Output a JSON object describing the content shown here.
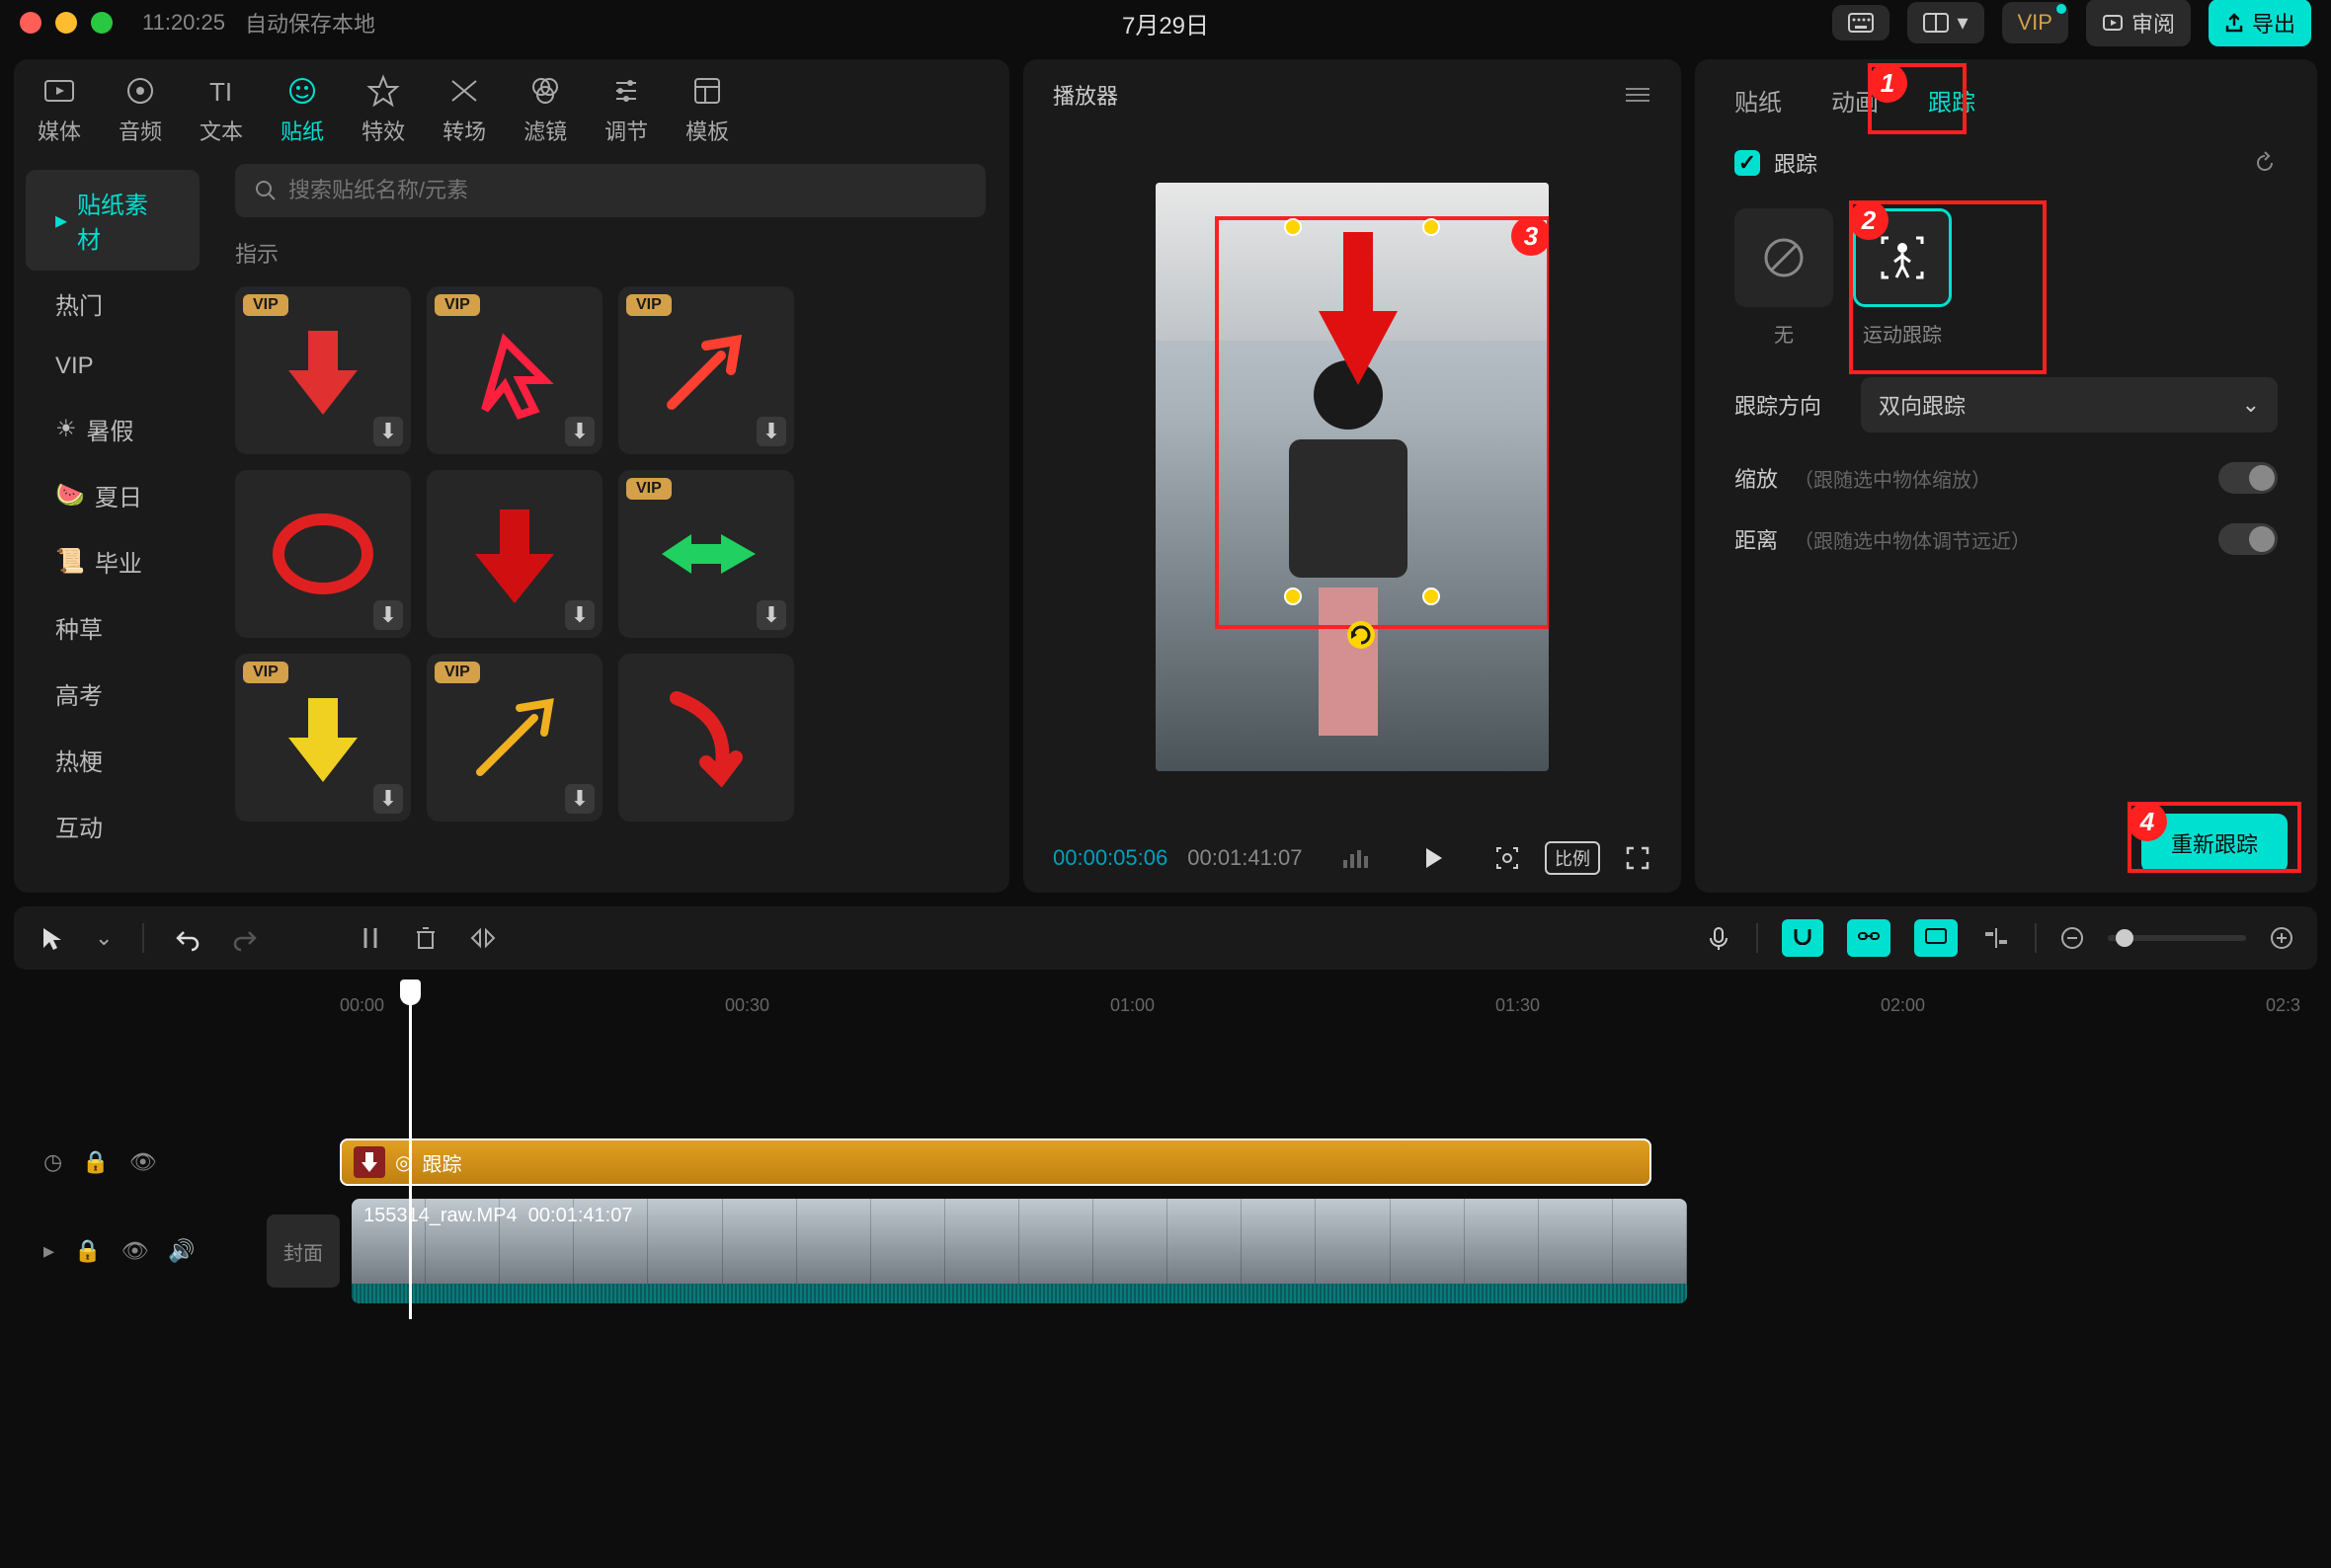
{
  "titlebar": {
    "timestamp": "11:20:25",
    "autosave": "自动保存本地",
    "doc_title": "7月29日",
    "vip": "VIP",
    "review": "审阅",
    "export": "导出"
  },
  "top_tabs": {
    "media": "媒体",
    "audio": "音频",
    "text": "文本",
    "sticker": "贴纸",
    "effect": "特效",
    "transition": "转场",
    "filter": "滤镜",
    "adjust": "调节",
    "template": "模板"
  },
  "sidebar": {
    "material": "贴纸素材",
    "hot": "热门",
    "vip": "VIP",
    "summer_vac": "暑假",
    "summer": "夏日",
    "graduation": "毕业",
    "grass": "种草",
    "gaokao": "高考",
    "meme": "热梗",
    "interact": "互动"
  },
  "search": {
    "placeholder": "搜索贴纸名称/元素"
  },
  "section": {
    "indicate": "指示"
  },
  "vip_label": "VIP",
  "player": {
    "title": "播放器",
    "current": "00:00:05:06",
    "total": "00:01:41:07",
    "ratio": "比例"
  },
  "props": {
    "tab_sticker": "贴纸",
    "tab_anim": "动画",
    "tab_track": "跟踪",
    "section_track": "跟踪",
    "opt_none": "无",
    "opt_motion": "运动跟踪",
    "dir_label": "跟踪方向",
    "dir_value": "双向跟踪",
    "scale_label": "缩放",
    "scale_hint": "（跟随选中物体缩放）",
    "dist_label": "距离",
    "dist_hint": "（跟随选中物体调节远近）",
    "retrack": "重新跟踪"
  },
  "annotations": {
    "n1": "1",
    "n2": "2",
    "n3": "3",
    "n4": "4"
  },
  "timeline": {
    "t0": "00:00",
    "t1": "00:30",
    "t2": "01:00",
    "t3": "01:30",
    "t4": "02:00",
    "t5": "02:3",
    "sticker_label": "跟踪",
    "video_file": "155314_raw.MP4",
    "video_dur": "00:01:41:07",
    "cover": "封面"
  }
}
